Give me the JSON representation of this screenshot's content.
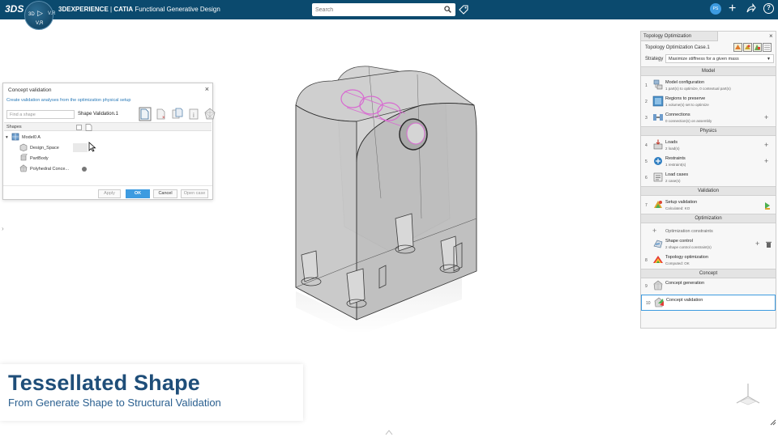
{
  "topbar": {
    "logo_text": "3DS",
    "compass": {
      "left": "3D",
      "right": "V.R",
      "version": "V,R"
    },
    "brand_bold": "3DEXPERIENCE",
    "brand_sep": " | ",
    "brand_catia": "CATIA",
    "brand_app": " Functional Generative Design",
    "search_placeholder": "Search",
    "avatar_initials": "PS",
    "icons": [
      "search-icon",
      "tag-icon",
      "add-icon",
      "share-icon",
      "help-icon"
    ]
  },
  "dialog": {
    "title": "Concept validation",
    "close": "×",
    "subtitle": "Create validation analyses from the optimization physical setup",
    "find_placeholder": "Find a shape",
    "shape_name": "Shape Validation.1",
    "shapes_header": "Shapes",
    "tree": [
      {
        "label": "Model0 A",
        "icon": "assembly-icon"
      },
      {
        "label": "Design_Space",
        "icon": "part-icon"
      },
      {
        "label": "PartBody",
        "icon": "body-icon"
      },
      {
        "label": "Polyhedral Conce...",
        "icon": "polyhedral-icon"
      }
    ],
    "buttons": {
      "apply": "Apply",
      "ok": "OK",
      "cancel": "Cancel",
      "open": "Open case"
    }
  },
  "panel": {
    "tab": "Topology Optimization",
    "close": "×",
    "case_name": "Topology Optimization Case.1",
    "strategy_label": "Strategy",
    "strategy_value": "Maximize stiffness for a given mass",
    "sections": {
      "model": "Model",
      "physics": "Physics",
      "validation": "Validation",
      "optimization": "Optimization",
      "concept": "Concept"
    },
    "steps": [
      {
        "num": "1",
        "title": "Model configuration",
        "desc": "1 part(s) to optimize, 0 contextual part(s)"
      },
      {
        "num": "2",
        "title": "Regions to preserve",
        "desc": "1 volume(s) set to optimize"
      },
      {
        "num": "3",
        "title": "Connections",
        "desc": "0 connection(s) on assembly",
        "action": "+"
      },
      {
        "num": "4",
        "title": "Loads",
        "desc": "2 load(s)",
        "action": "+"
      },
      {
        "num": "5",
        "title": "Restraints",
        "desc": "1 restraint(s)",
        "action": "+"
      },
      {
        "num": "6",
        "title": "Load cases",
        "desc": "2 case(s)"
      },
      {
        "num": "7",
        "title": "Setup validation",
        "desc": "Calculated: KO"
      },
      {
        "num": "",
        "title": "Optimization constraints",
        "desc": ""
      },
      {
        "num": "",
        "title": "Shape control",
        "desc": "2 shape control constraint(s)",
        "action": "+",
        "action2": "🗑"
      },
      {
        "num": "8",
        "title": "Topology optimization",
        "desc": "Computed: OK"
      },
      {
        "num": "9",
        "title": "Concept generation",
        "desc": ""
      },
      {
        "num": "10",
        "title": "Concept validation",
        "desc": ""
      }
    ]
  },
  "title_card": {
    "title": "Tessellated Shape",
    "subtitle": "From Generate Shape to Structural Validation"
  },
  "colors": {
    "topbar": "#0b4a6e",
    "accent": "#3d9be0",
    "title": "#1f4e79",
    "highlight": "#d86bd1"
  }
}
